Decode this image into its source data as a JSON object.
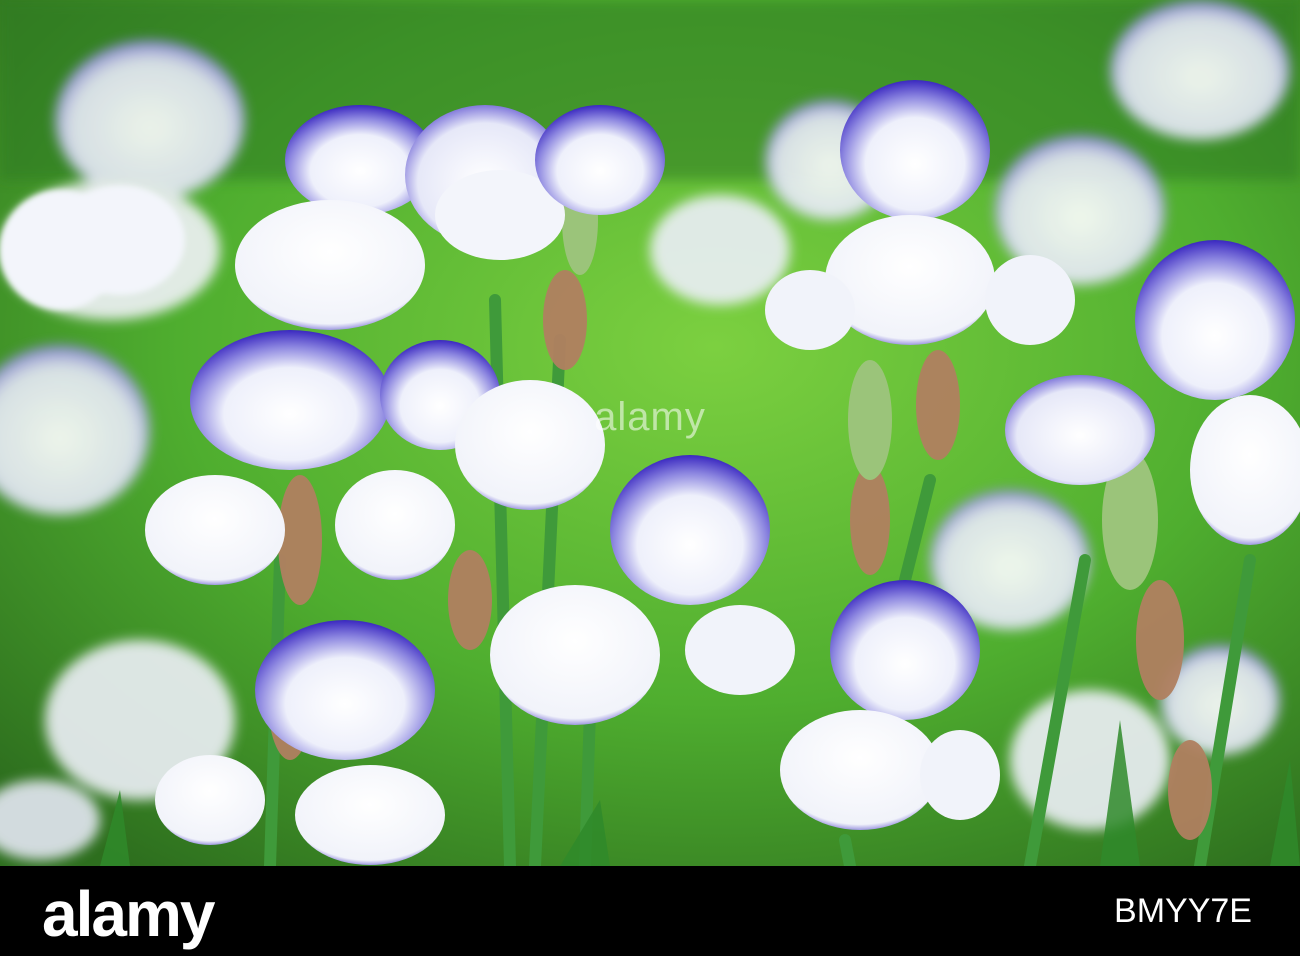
{
  "photo": {
    "subject": "",
    "colors": {
      "background_green": "#5fb833",
      "background_dark": "#2d6e1e",
      "petal_white": "#f3f5fb",
      "petal_purple": "#3b2bbf",
      "stem_green": "#3f9a3a",
      "bud_tan": "#b08060"
    }
  },
  "watermark": {
    "center_text": "alamy"
  },
  "footer": {
    "logo": "alamy",
    "image_id": "BMYY7E"
  }
}
